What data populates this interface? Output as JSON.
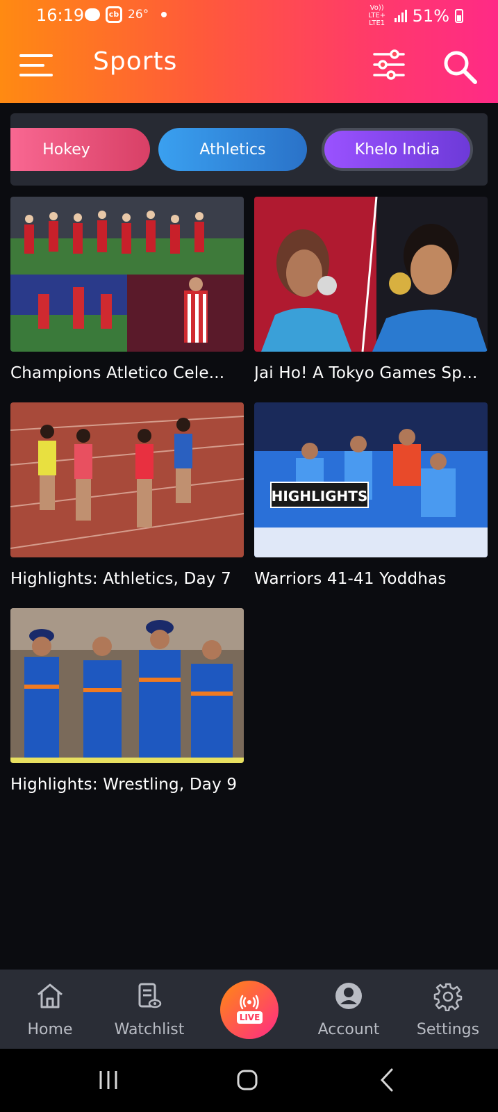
{
  "status_bar": {
    "time": "16:19",
    "temp": "26°",
    "network": "Vo)) LTE+ LTE1",
    "battery": "51%"
  },
  "header": {
    "title": "Sports",
    "menu_icon": "hamburger-menu-icon",
    "filter_icon": "sliders-filter-icon",
    "search_icon": "search-icon"
  },
  "categories": [
    {
      "label": "Hokey"
    },
    {
      "label": "Athletics"
    },
    {
      "label": "Khelo India",
      "selected": true
    }
  ],
  "videos": [
    {
      "title": "Champions Atletico Cele..."
    },
    {
      "title": "Jai Ho! A Tokyo Games Sp..."
    },
    {
      "title": "Highlights: Athletics, Day 7"
    },
    {
      "title": "Warriors 41-41 Yoddhas",
      "thumb_overlay": "HIGHLIGHTS"
    },
    {
      "title": "Highlights: Wrestling, Day 9"
    }
  ],
  "bottom_nav": {
    "home": "Home",
    "watchlist": "Watchlist",
    "live": "LIVE",
    "account": "Account",
    "settings": "Settings"
  },
  "colors": {
    "header_start": "#ff8a12",
    "header_end": "#ff2a86",
    "background": "#0b0c10",
    "nav_background": "#2a2d36"
  }
}
